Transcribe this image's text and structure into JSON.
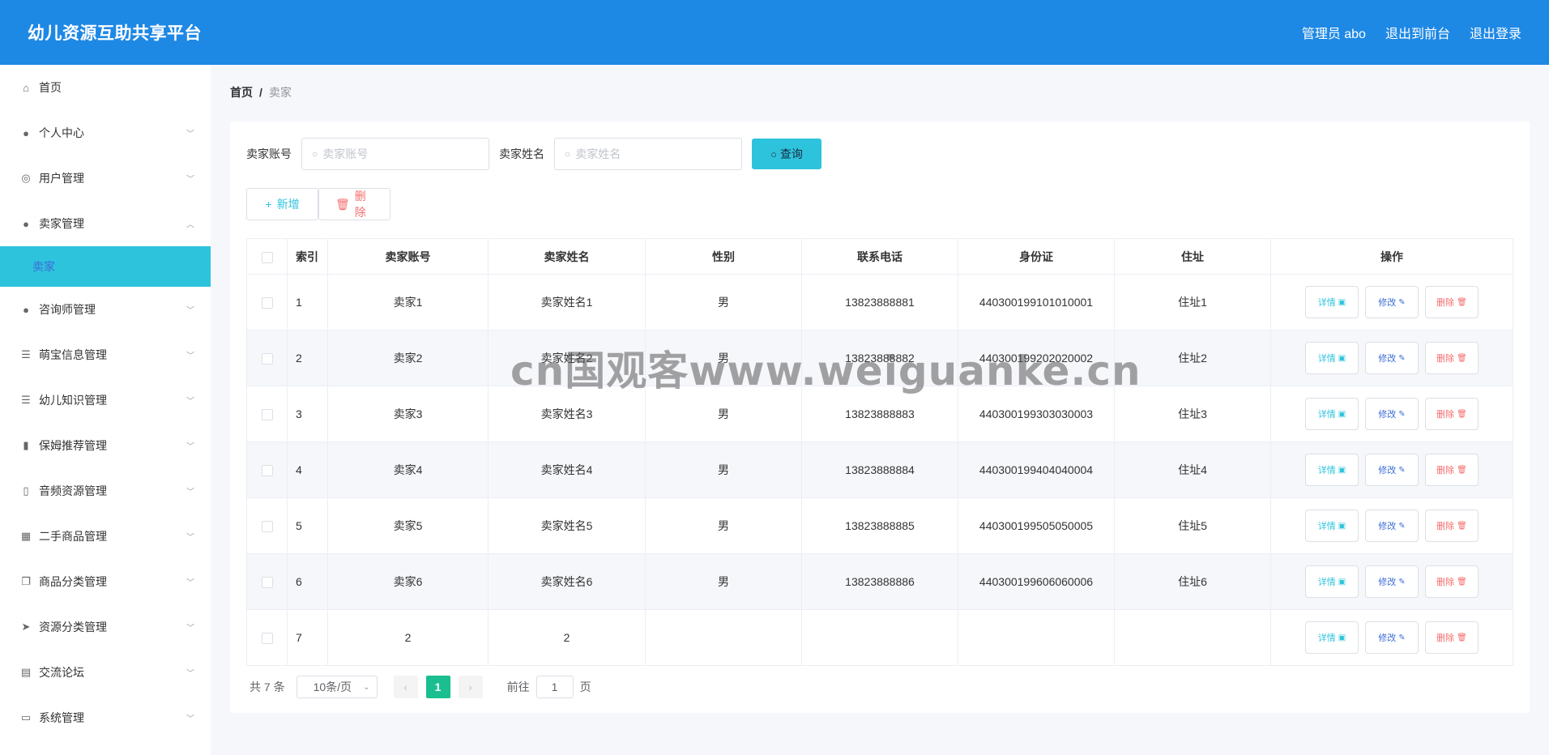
{
  "header": {
    "title": "幼儿资源互助共享平台",
    "admin": "管理员 abo",
    "exit_front": "退出到前台",
    "logout": "退出登录"
  },
  "sidebar": {
    "items": [
      {
        "label": "首页",
        "icon": "home-icon",
        "glyph": "⌂",
        "chevron": false
      },
      {
        "label": "个人中心",
        "icon": "user-icon",
        "glyph": "●",
        "chevron": true
      },
      {
        "label": "用户管理",
        "icon": "lifebuoy-icon",
        "glyph": "◎",
        "chevron": true
      },
      {
        "label": "卖家管理",
        "icon": "person-icon",
        "glyph": "●",
        "chevron": true,
        "expanded": true
      },
      {
        "label": "咨询师管理",
        "icon": "bulb-icon",
        "glyph": "●",
        "chevron": true
      },
      {
        "label": "萌宝信息管理",
        "icon": "list-icon",
        "glyph": "☰",
        "chevron": true
      },
      {
        "label": "幼儿知识管理",
        "icon": "list-alt-icon",
        "glyph": "☰",
        "chevron": true
      },
      {
        "label": "保姆推荐管理",
        "icon": "bar-chart-icon",
        "glyph": "▮",
        "chevron": true
      },
      {
        "label": "音频资源管理",
        "icon": "mobile-icon",
        "glyph": "▯",
        "chevron": true
      },
      {
        "label": "二手商品管理",
        "icon": "grid-icon",
        "glyph": "▦",
        "chevron": true
      },
      {
        "label": "商品分类管理",
        "icon": "copy-icon",
        "glyph": "❐",
        "chevron": true
      },
      {
        "label": "资源分类管理",
        "icon": "send-icon",
        "glyph": "➤",
        "chevron": true
      },
      {
        "label": "交流论坛",
        "icon": "chart-icon",
        "glyph": "▤",
        "chevron": true
      },
      {
        "label": "系统管理",
        "icon": "briefcase-icon",
        "glyph": "▭",
        "chevron": true
      }
    ],
    "sub_active": "卖家"
  },
  "breadcrumb": {
    "home": "首页",
    "sep": "/",
    "current": "卖家"
  },
  "search": {
    "account_label": "卖家账号",
    "account_placeholder": "卖家账号",
    "name_label": "卖家姓名",
    "name_placeholder": "卖家姓名",
    "query_button": "查询"
  },
  "actions": {
    "add": "新增",
    "delete": "删除"
  },
  "table": {
    "columns": [
      "索引",
      "卖家账号",
      "卖家姓名",
      "性别",
      "联系电话",
      "身份证",
      "住址",
      "操作"
    ],
    "rows": [
      {
        "index": "1",
        "account": "卖家1",
        "name": "卖家姓名1",
        "gender": "男",
        "phone": "13823888881",
        "idcard": "440300199101010001",
        "address": "住址1"
      },
      {
        "index": "2",
        "account": "卖家2",
        "name": "卖家姓名2",
        "gender": "男",
        "phone": "13823888882",
        "idcard": "440300199202020002",
        "address": "住址2"
      },
      {
        "index": "3",
        "account": "卖家3",
        "name": "卖家姓名3",
        "gender": "男",
        "phone": "13823888883",
        "idcard": "440300199303030003",
        "address": "住址3"
      },
      {
        "index": "4",
        "account": "卖家4",
        "name": "卖家姓名4",
        "gender": "男",
        "phone": "13823888884",
        "idcard": "440300199404040004",
        "address": "住址4"
      },
      {
        "index": "5",
        "account": "卖家5",
        "name": "卖家姓名5",
        "gender": "男",
        "phone": "13823888885",
        "idcard": "440300199505050005",
        "address": "住址5"
      },
      {
        "index": "6",
        "account": "卖家6",
        "name": "卖家姓名6",
        "gender": "男",
        "phone": "13823888886",
        "idcard": "440300199606060006",
        "address": "住址6"
      },
      {
        "index": "7",
        "account": "2",
        "name": "2",
        "gender": "",
        "phone": "",
        "idcard": "",
        "address": ""
      }
    ],
    "row_buttons": {
      "detail": "详情",
      "edit": "修改",
      "delete": "删除"
    }
  },
  "pagination": {
    "total": "共 7 条",
    "page_size": "10条/页",
    "current_page": "1",
    "goto_prefix": "前往",
    "goto_value": "1",
    "goto_suffix": "页"
  },
  "watermark": "cn国观客www.weiguanke.cn",
  "colors": {
    "header": "#1e88e5",
    "accent": "#2ec3dc",
    "danger": "#f56c6c",
    "page_active": "#1bbf8f"
  }
}
